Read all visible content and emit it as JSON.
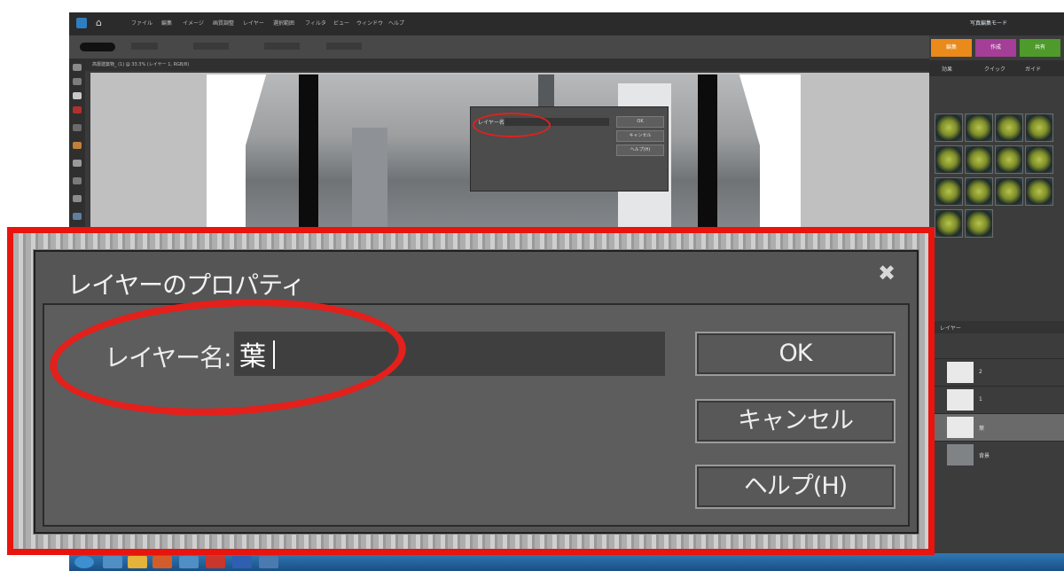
{
  "menu": [
    "ファイル",
    "編集",
    "イメージ",
    "画質調整",
    "レイヤー",
    "選択範囲",
    "フィルタ",
    "ビュー",
    "ウィンドウ",
    "ヘルプ"
  ],
  "mode_label": "写真編集モード",
  "panel_tabs": [
    "編集",
    "作成",
    "共有"
  ],
  "panel_subtabs": [
    "効果",
    "クイック",
    "ガイド"
  ],
  "document_tab": "高層建築物_ (1) @ 33.3% (レイヤー 1, RGB/8)",
  "layers_title": "レイヤー",
  "layers": [
    {
      "name": "2",
      "kind": "blank"
    },
    {
      "name": "1",
      "kind": "blank"
    },
    {
      "name": "葉",
      "kind": "blank"
    },
    {
      "name": "背景",
      "kind": "photo"
    }
  ],
  "mini_dialog": {
    "label": "レイヤー名: 葉",
    "ok": "OK",
    "cancel": "キャンセル",
    "help": "ヘルプ(H)"
  },
  "dialog": {
    "title": "レイヤーのプロパティ",
    "field_label": "レイヤー名:",
    "field_value": "葉",
    "ok_label": "OK",
    "cancel_label": "キャンセル",
    "help_label": "ヘルプ(H)"
  },
  "icons": {
    "close": "close-icon",
    "home": "home-icon"
  },
  "colors": {
    "highlight": "#e3201b",
    "edit_tab": "#e98a1a",
    "create_tab": "#a43e96",
    "share_tab": "#4e9a2b"
  }
}
